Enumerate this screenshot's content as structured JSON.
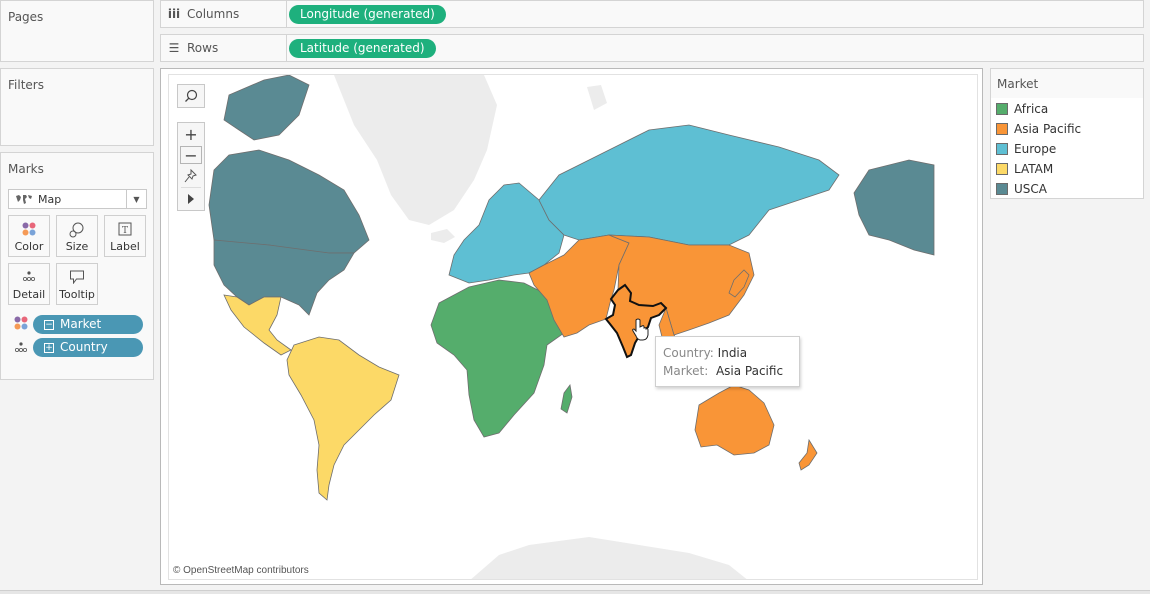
{
  "pages": {
    "title": "Pages"
  },
  "filters": {
    "title": "Filters"
  },
  "shelves": {
    "columns": {
      "label": "Columns",
      "icon": "columns-icon",
      "pill": "Longitude (generated)"
    },
    "rows": {
      "label": "Rows",
      "icon": "rows-icon",
      "pill": "Latitude (generated)"
    }
  },
  "marks": {
    "title": "Marks",
    "type": "Map",
    "buttons": [
      {
        "label": "Color",
        "icon": "color-icon"
      },
      {
        "label": "Size",
        "icon": "size-icon"
      },
      {
        "label": "Label",
        "icon": "label-icon"
      },
      {
        "label": "Detail",
        "icon": "detail-icon"
      },
      {
        "label": "Tooltip",
        "icon": "tooltip-icon"
      }
    ],
    "fields": [
      {
        "label": "Market",
        "encoding": "color",
        "expand": "−"
      },
      {
        "label": "Country",
        "encoding": "detail",
        "expand": "+"
      }
    ]
  },
  "map": {
    "attribution": "© OpenStreetMap contributors",
    "controls": [
      "search",
      "zoom-in",
      "zoom-out",
      "pin",
      "expand"
    ],
    "tooltip": {
      "rows": [
        {
          "key": "Country:",
          "value": "India"
        },
        {
          "key": "Market:",
          "value": "Asia Pacific"
        }
      ]
    },
    "highlighted_country": "India"
  },
  "legend": {
    "title": "Market",
    "items": [
      {
        "label": "Africa",
        "color": "#55ad6c"
      },
      {
        "label": "Asia Pacific",
        "color": "#f99537"
      },
      {
        "label": "Europe",
        "color": "#5ebfd3"
      },
      {
        "label": "LATAM",
        "color": "#fcd967"
      },
      {
        "label": "USCA",
        "color": "#5a8a93"
      }
    ]
  }
}
